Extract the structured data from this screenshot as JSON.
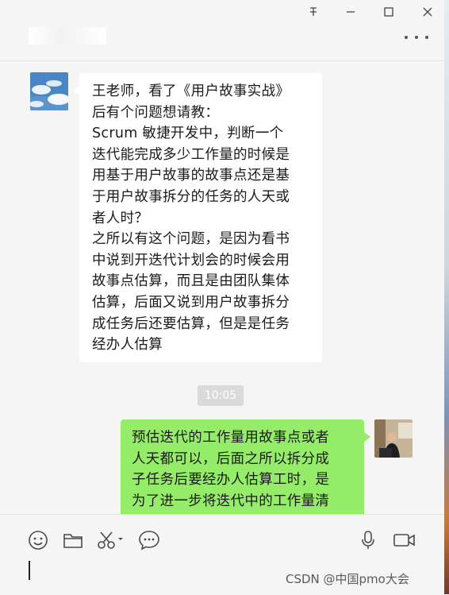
{
  "window": {
    "controls": [
      {
        "name": "pin-icon"
      },
      {
        "name": "minimize-icon"
      },
      {
        "name": "maximize-icon"
      },
      {
        "name": "close-icon"
      }
    ]
  },
  "chat_header": {
    "contact_name": "",
    "more_icon": "more-icon"
  },
  "messages": {
    "received": {
      "lines": [
        "王老师，看了《用户故事实战》",
        "后有个问题想请教：",
        "Scrum 敏捷开发中，判断一个",
        "迭代能完成多少工作量的时候是",
        "用基于用户故事的故事点还是基",
        "于用户故事拆分的任务的人天或",
        "者人时？",
        "之所以有这个问题，是因为看书",
        "中说到开迭代计划会的时候会用",
        "故事点估算，而且是由团队集体",
        "估算，后面又说到用户故事拆分",
        "成任务后还要估算，但是是任务",
        "经办人估算"
      ]
    },
    "timestamp": "10:05",
    "sent": {
      "lines": [
        "预估迭代的工作量用故事点或者",
        "人天都可以，后面之所以拆分成",
        "子任务后要经办人估算工时，是",
        "为了进一步将迭代中的工作量清"
      ]
    }
  },
  "toolbar": {
    "left": [
      "emoji-icon",
      "folder-icon",
      "scissors-icon",
      "chat-history-icon"
    ],
    "right": [
      "microphone-icon",
      "video-call-icon"
    ]
  },
  "colors": {
    "sent_bubble": "#95ec69",
    "received_bubble": "#ffffff",
    "background": "#f5f5f5"
  },
  "watermark": "CSDN @中国pmo大会"
}
